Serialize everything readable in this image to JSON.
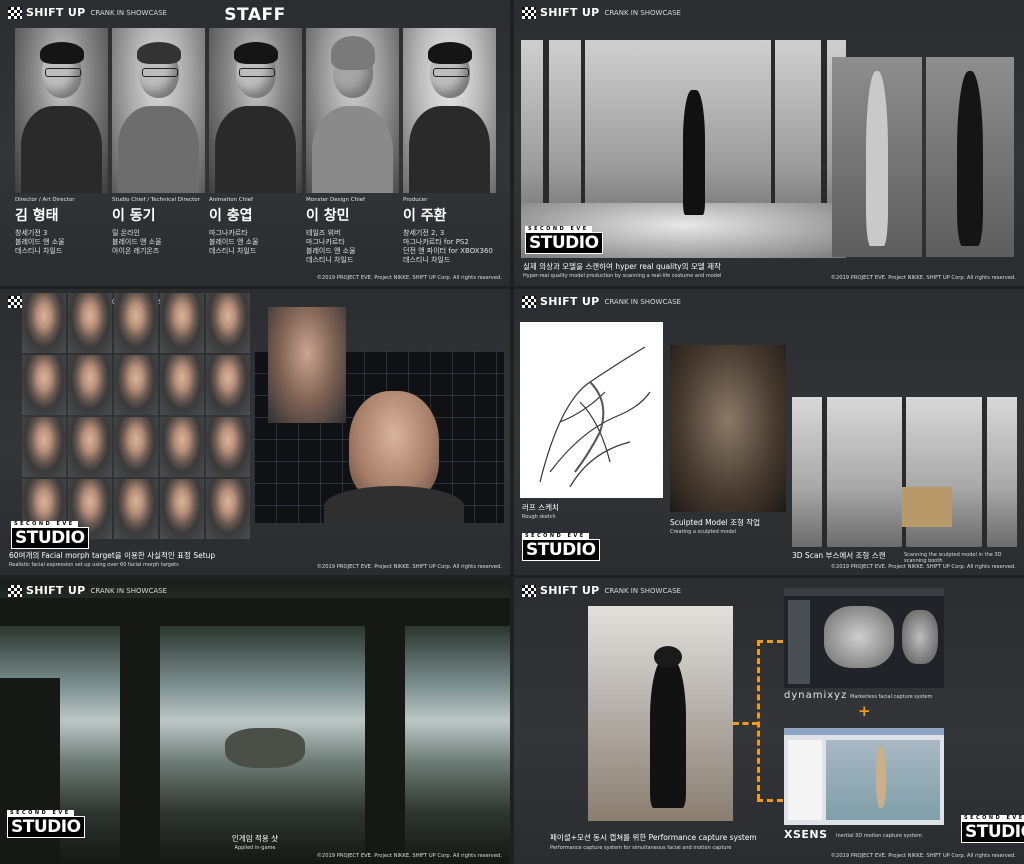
{
  "brand": {
    "name": "SHIFT UP",
    "tag": "CRANK IN SHOWCASE"
  },
  "copyright": "©2019 PROJECT EVE. Project NIKKE. SHIFT UP Corp. All rights reserved.",
  "studio_logo": {
    "top": "SECOND EVE",
    "main": "STUDIO"
  },
  "slide1": {
    "title": "STAFF",
    "staff": [
      {
        "role": "Director / Art Director",
        "name": "김 형태",
        "works": [
          "창세기전 3",
          "블레이드 앤 소울",
          "데스티니 차일드"
        ]
      },
      {
        "role": "Studio Chief / Technical Director",
        "name": "이 동기",
        "works": [
          "릴 온라인",
          "블레이드 앤 소울",
          "아이온 레기온즈"
        ]
      },
      {
        "role": "Animation Chief",
        "name": "이 충엽",
        "works": [
          "마그나카르타",
          "블레이드 앤 소울",
          "데스티니 차일드"
        ]
      },
      {
        "role": "Monster Design Chief",
        "name": "이 창민",
        "works": [
          "테일즈 위버",
          "마그나카르타",
          "블레이드 앤 소울",
          "데스티니 차일드"
        ]
      },
      {
        "role": "Producer",
        "name": "이 주환",
        "works": [
          "창세기전 2, 3",
          "마그나카르타 for PS2",
          "던전 앤 파이터 for XBOX360",
          "데스티니 차일드"
        ]
      }
    ]
  },
  "slide2": {
    "caption_kr": "실제 의상과 모델을 스캔하여 hyper real quality의 모델 제작",
    "caption_en": "Hyper-real quality model production by scanning a real-life costume and model"
  },
  "slide3": {
    "caption_kr": "60여개의 Facial morph target을 이용한 사실적인 표정 Setup",
    "caption_en": "Realistic facial expression set up using over 60 facial morph targets"
  },
  "slide4": {
    "sketch_kr": "러프 스케치",
    "sketch_en": "Rough sketch",
    "sculpt_kr": "Sculpted Model 조형 작업",
    "sculpt_en": "Creating a sculpted model",
    "scan_kr": "3D Scan 부스에서 조형 스캔",
    "scan_en": "Scanning the sculpted model in the 3D scanning booth"
  },
  "slide5": {
    "caption_kr": "인게임 적용 샷",
    "caption_en": "Applied in-game"
  },
  "slide6": {
    "caption_kr": "페이셜+모션 동시 캡쳐를 위한 Performance capture system",
    "caption_en": "Performance capture system for simultaneous facial and motion capture",
    "dynamixyz": "dynamixyz",
    "dynamixyz_desc": "Markerless facial capture system",
    "plus": "+",
    "xsens": "XSENS",
    "xsens_desc": "Inertial 3D motion capture system"
  },
  "colors": {
    "accent_orange": "#f29a1a",
    "slide_bg": "#2f3135"
  }
}
